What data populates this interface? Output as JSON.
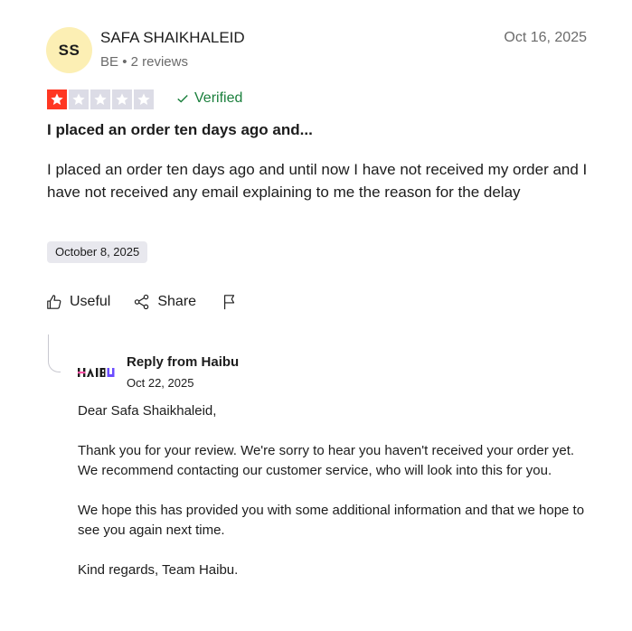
{
  "reviewer": {
    "initials": "SS",
    "name": "SAFA SHAIKHALEID",
    "country": "BE",
    "reviews": "2 reviews",
    "separator": "•"
  },
  "review": {
    "posted_date": "Oct 16, 2025",
    "rating": 1,
    "rating_max": 5,
    "verified_label": "Verified",
    "title": "I placed an order ten days ago and...",
    "body": "I placed an order ten days ago and until now I have not received my order and I have not received any email explaining to me the reason for the delay",
    "experience_date": "October 8, 2025"
  },
  "actions": {
    "useful": "Useful",
    "share": "Share"
  },
  "reply": {
    "logo_text": "HAIBU",
    "from": "Reply from Haibu",
    "date": "Oct 22, 2025",
    "paragraphs": [
      "Dear Safa Shaikhaleid,",
      "Thank you for your review. We're sorry to hear you haven't received your order yet. We recommend contacting our customer service, who will look into this for you.",
      "We hope this has provided you with some additional information and that we hope to see you again next time.",
      "Kind regards, Team Haibu."
    ]
  },
  "colors": {
    "star_active": "#ff3722",
    "star_inactive": "#dcdce6",
    "verified": "#1a7f3c",
    "avatar_bg": "#fcefb4"
  }
}
